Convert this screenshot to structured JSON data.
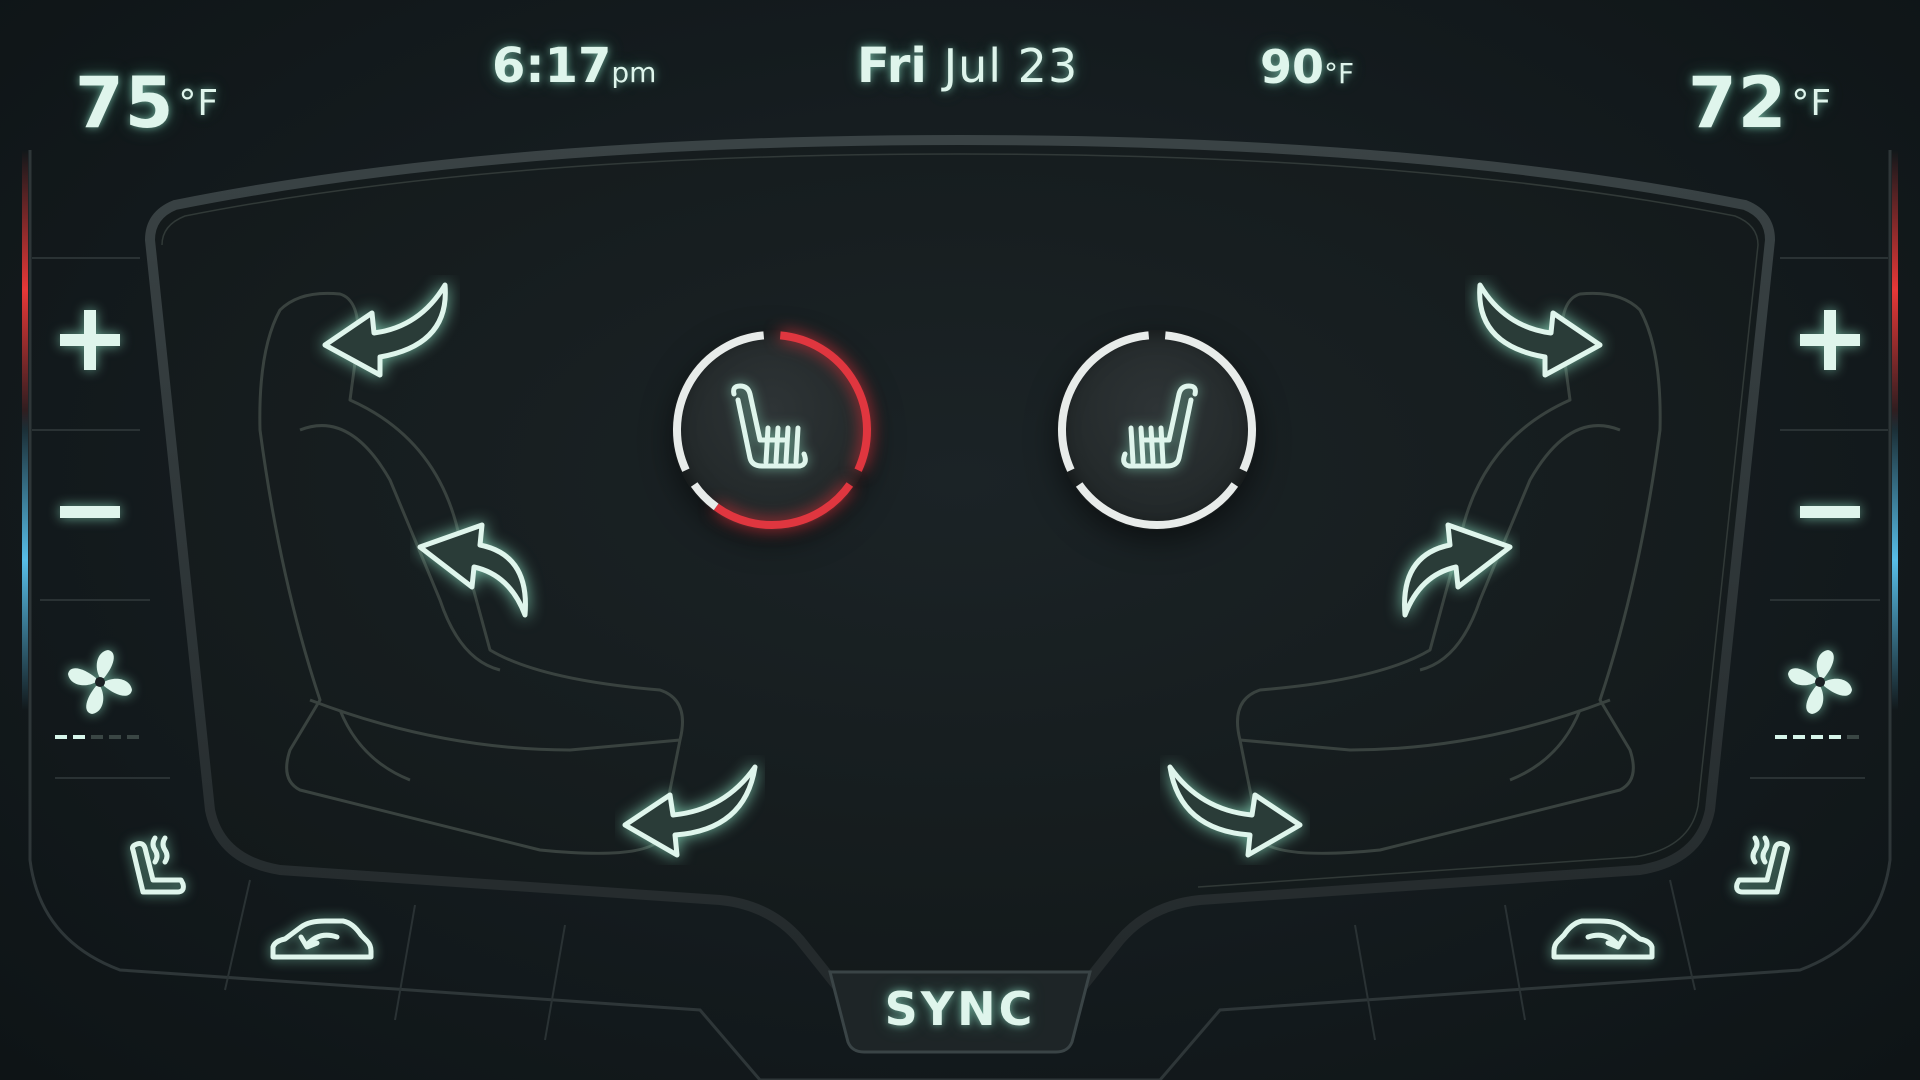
{
  "climate": {
    "driver": {
      "temperature": "75",
      "unit": "°F"
    },
    "passenger": {
      "temperature": "72",
      "unit": "°F"
    }
  },
  "status_bar": {
    "time": "6:17",
    "time_suffix": "pm",
    "day": "Fri",
    "date": "Jul 23",
    "outside_temperature": "90",
    "outside_unit": "°F"
  },
  "controls": {
    "sync_label": "SYNC"
  },
  "icons": {
    "increase": "plus-icon",
    "decrease": "minus-icon",
    "fan": "fan-icon",
    "seat_heat": "seat-heat-icon",
    "recirculation": "recirculation-icon",
    "seat_adjust_arrows": "curved-arrow-icon"
  },
  "seat_heating": {
    "driver_level": 0.6,
    "passenger_level": 0
  },
  "fan_speed": {
    "driver_level": 2,
    "passenger_level": 4,
    "max_level": 5
  },
  "colors": {
    "accent": "#d7f5ea",
    "heat_active": "#e0363f",
    "heat_inactive": "#e8ecea"
  }
}
